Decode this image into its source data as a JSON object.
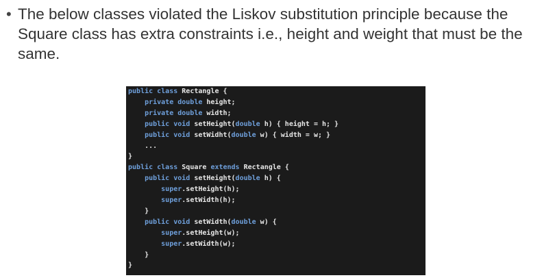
{
  "bullet": {
    "glyph": "•",
    "text": "The below classes violated the Liskov substitution principle because the Square class has extra constraints i.e., height and weight that must be the same."
  },
  "code": {
    "lines": [
      [
        {
          "t": "public class ",
          "k": "kw"
        },
        {
          "t": "Rectangle {",
          "k": "plain"
        }
      ],
      [
        {
          "t": "    private double ",
          "k": "kw"
        },
        {
          "t": "height;",
          "k": "plain"
        }
      ],
      [
        {
          "t": "    private double ",
          "k": "kw"
        },
        {
          "t": "width;",
          "k": "plain"
        }
      ],
      [
        {
          "t": "    public void ",
          "k": "kw"
        },
        {
          "t": "setHeight(",
          "k": "plain"
        },
        {
          "t": "double ",
          "k": "kw"
        },
        {
          "t": "h) { height = h; }",
          "k": "plain"
        }
      ],
      [
        {
          "t": "    public void ",
          "k": "kw"
        },
        {
          "t": "setWidht(",
          "k": "plain"
        },
        {
          "t": "double ",
          "k": "kw"
        },
        {
          "t": "w) { width = w; }",
          "k": "plain"
        }
      ],
      [
        {
          "t": "    ...",
          "k": "plain"
        }
      ],
      [
        {
          "t": "}",
          "k": "plain"
        }
      ],
      [
        {
          "t": "public class ",
          "k": "kw"
        },
        {
          "t": "Square ",
          "k": "plain"
        },
        {
          "t": "extends ",
          "k": "kw"
        },
        {
          "t": "Rectangle {",
          "k": "plain"
        }
      ],
      [
        {
          "t": "    public void ",
          "k": "kw"
        },
        {
          "t": "setHeight(",
          "k": "plain"
        },
        {
          "t": "double ",
          "k": "kw"
        },
        {
          "t": "h) {",
          "k": "plain"
        }
      ],
      [
        {
          "t": "        super",
          "k": "kw"
        },
        {
          "t": ".setHeight(h);",
          "k": "plain"
        }
      ],
      [
        {
          "t": "        super",
          "k": "kw"
        },
        {
          "t": ".setWidth(h);",
          "k": "plain"
        }
      ],
      [
        {
          "t": "    }",
          "k": "plain"
        }
      ],
      [
        {
          "t": "    public void ",
          "k": "kw"
        },
        {
          "t": "setWidth(",
          "k": "plain"
        },
        {
          "t": "double ",
          "k": "kw"
        },
        {
          "t": "w) {",
          "k": "plain"
        }
      ],
      [
        {
          "t": "        super",
          "k": "kw"
        },
        {
          "t": ".setHeight(w);",
          "k": "plain"
        }
      ],
      [
        {
          "t": "        super",
          "k": "kw"
        },
        {
          "t": ".setWidth(w);",
          "k": "plain"
        }
      ],
      [
        {
          "t": "    }",
          "k": "plain"
        }
      ],
      [
        {
          "t": "}",
          "k": "plain"
        }
      ]
    ]
  },
  "colors": {
    "keyword": "#6fa0dc",
    "text": "#e8e8e8",
    "code_background": "#1b1b1b"
  }
}
